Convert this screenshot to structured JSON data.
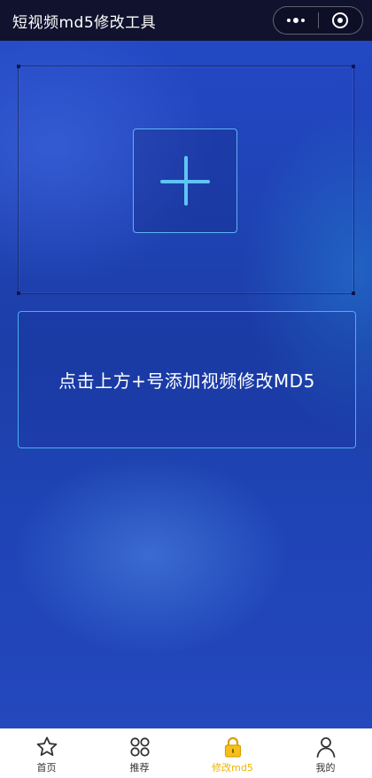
{
  "header": {
    "title": "短视频md5修改工具",
    "more_icon": "more-dots-icon",
    "close_icon": "target-circle-icon"
  },
  "main": {
    "add_icon": "plus-icon",
    "hint_text": "点击上方+号添加视频修改MD5"
  },
  "tabbar": {
    "active_color": "#f0b400",
    "items": [
      {
        "label": "首页",
        "icon": "star-icon",
        "active": false
      },
      {
        "label": "推荐",
        "icon": "grid-icon",
        "active": false
      },
      {
        "label": "修改md5",
        "icon": "lock-icon",
        "active": true
      },
      {
        "label": "我的",
        "icon": "user-icon",
        "active": false
      }
    ]
  },
  "colors": {
    "header_bg": "#11122e",
    "accent_border": "#48b0ec",
    "background": "#1e3fb0"
  }
}
